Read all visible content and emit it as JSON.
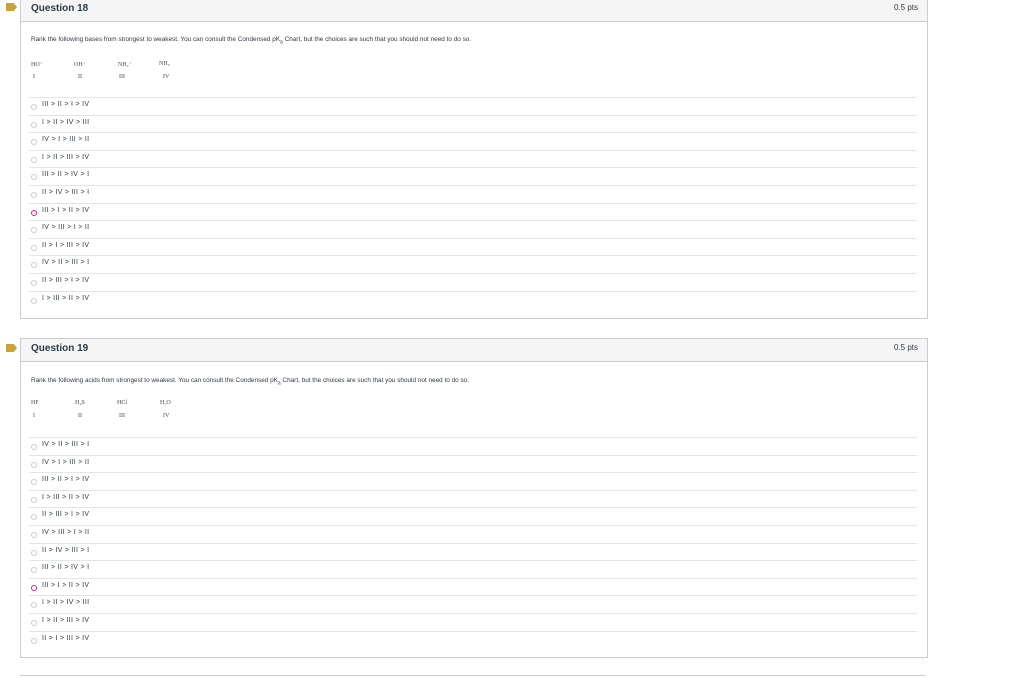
{
  "questions": [
    {
      "title": "Question 18",
      "points": "0.5 pts",
      "text_before": "Rank the following bases from strongest to weakest. You can consult the Condensed pK",
      "text_sub": "a",
      "text_after": " Chart, but the choices are such that you should not need to do so.",
      "species": [
        {
          "formula": "HO⁻",
          "numeral": "I"
        },
        {
          "formula": "OH⁻",
          "numeral": "II"
        },
        {
          "formula": "NH₂⁻",
          "numeral": "III"
        },
        {
          "formula": "NH₃",
          "numeral": "IV"
        }
      ],
      "answers": [
        "III > II > I > IV",
        "I > II > IV > III",
        "IV > I > III > II",
        "I > II > III > IV",
        "III > II > IV > I",
        "II > IV > III > I",
        "III > I > II > IV",
        "IV > III > I > II",
        "II > I > III > IV",
        "IV > II > III > I",
        "II > III > I > IV",
        "I > III > II > IV"
      ],
      "selected_index": 6
    },
    {
      "title": "Question 19",
      "points": "0.5 pts",
      "text_before": "Rank the following acids from strongest to weakest. You can consult the Condensed pK",
      "text_sub": "a",
      "text_after": " Chart, but the choices are such that you should not need to do so.",
      "species": [
        {
          "formula": "HF",
          "numeral": "I"
        },
        {
          "formula": "H₂S",
          "numeral": "II"
        },
        {
          "formula": "HCl",
          "numeral": "III"
        },
        {
          "formula": "H₂O",
          "numeral": "IV"
        }
      ],
      "answers": [
        "IV > II > III > I",
        "IV > I > III > II",
        "III > II > I > IV",
        "I > III > II > IV",
        "II > III > I > IV",
        "IV > III > I > II",
        "II > IV > III > I",
        "III > II > IV > I",
        "III > I > II > IV",
        "I > II > IV > III",
        "I > II > III > IV",
        "II > I > III > IV"
      ],
      "selected_index": 8
    }
  ],
  "colors": {
    "flag": "#c9a33a",
    "selected_radio": "#e0218a",
    "border": "#c7cdd1",
    "header_bg": "#f5f5f5"
  }
}
